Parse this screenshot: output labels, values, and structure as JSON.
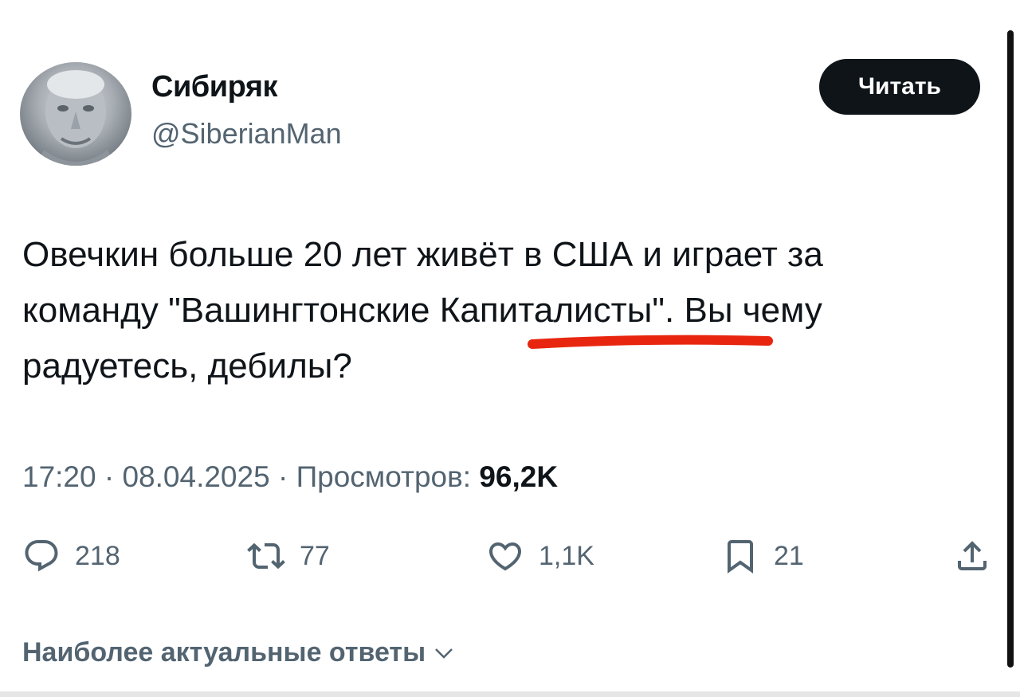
{
  "author": {
    "display_name": "Сибиряк",
    "handle": "@SiberianMan",
    "follow_label": "Читать",
    "avatar_icon": "frosted-man-avatar"
  },
  "tweet": {
    "lines": [
      "Овечкин больше 20 лет живёт в США и играет  за",
      "команду \"Вашингтонские Капиталисты\". Вы чему",
      "радуетесь, дебилы?"
    ],
    "underline_color": "#e8260f",
    "time": "17:20",
    "separator": "·",
    "date": "08.04.2025",
    "views_label": "Просмотров:",
    "views_count": "96,2K"
  },
  "actions": {
    "reply": {
      "icon": "reply-icon",
      "count": "218"
    },
    "retweet": {
      "icon": "retweet-icon",
      "count": "77"
    },
    "like": {
      "icon": "heart-icon",
      "count": "1,1K"
    },
    "bookmark": {
      "icon": "bookmark-icon",
      "count": "21"
    },
    "share": {
      "icon": "share-icon"
    }
  },
  "replies": {
    "sort_label": "Наиболее актуальные ответы"
  },
  "colors": {
    "text": "#0f1419",
    "secondary": "#536471",
    "button_bg": "#0f1419",
    "button_text": "#ffffff"
  }
}
